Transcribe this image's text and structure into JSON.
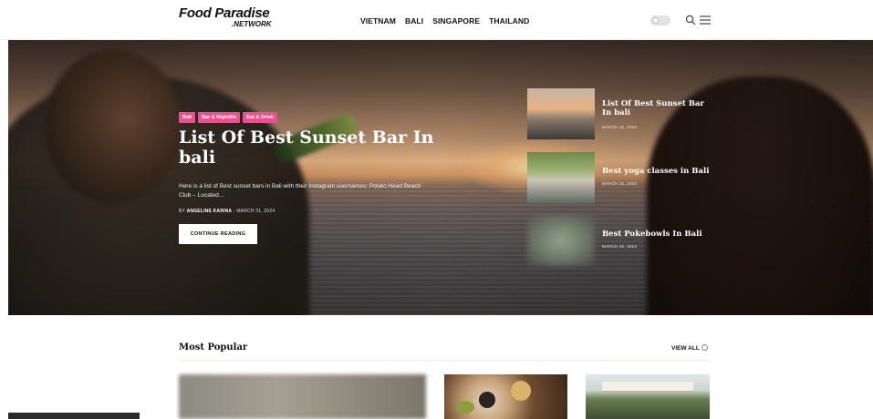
{
  "header": {
    "logo_main": "Food Paradise",
    "logo_sub": ".NETWORK",
    "nav": [
      "VIETNAM",
      "BALI",
      "SINGAPORE",
      "THAILAND"
    ]
  },
  "hero": {
    "tags": [
      "Bali",
      "Bar & Nightlife",
      "Eat & Drink"
    ],
    "title": "List Of Best Sunset Bar In bali",
    "excerpt": "Here is a list of Best sunset bars in Bali with their Instagram usernames: Potato Head Beach Club – Located…",
    "meta_by": "BY",
    "meta_author": "ANGELINE KARINA",
    "meta_sep": "-",
    "meta_date": "MARCH 31, 2024",
    "button": "CONTINUE READING"
  },
  "side_posts": [
    {
      "title": "List Of Best Sunset Bar In bali",
      "date": "MARCH 31, 2024"
    },
    {
      "title": "Best yoga classes in Bali",
      "date": "MARCH 31, 2024"
    },
    {
      "title": "Best Pokebowls In Bali",
      "date": "MARCH 31, 2024"
    }
  ],
  "popular": {
    "title": "Most Popular",
    "view_all": "VIEW ALL"
  },
  "colors": {
    "tag_pink": "#e8518f",
    "text_dark": "#111111"
  },
  "icons": [
    "toggle-icon",
    "search-icon",
    "menu-icon",
    "arrow-circle-icon"
  ]
}
